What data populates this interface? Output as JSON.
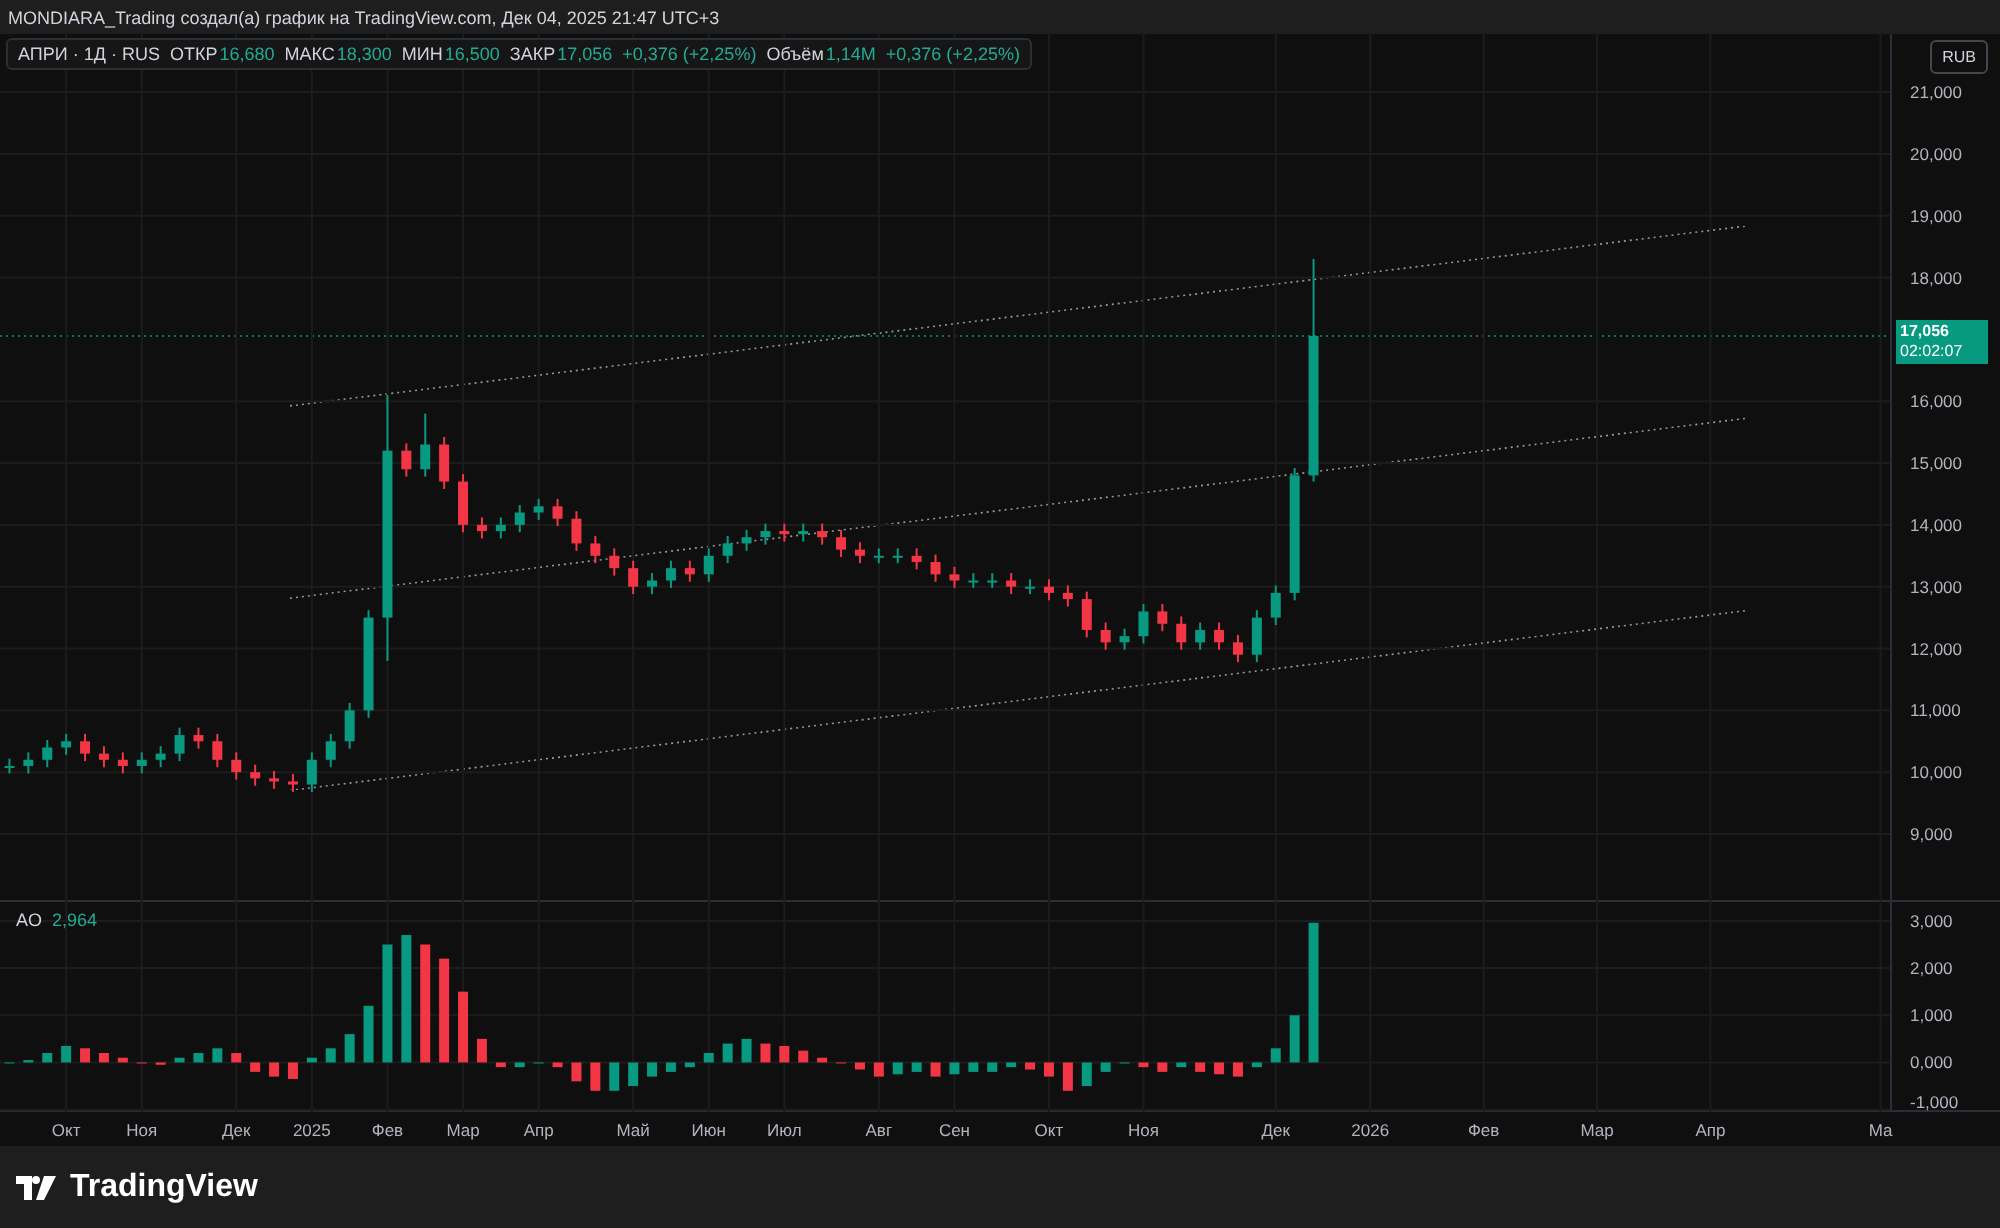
{
  "header": {
    "text": "MONDIARA_Trading создал(а) график на TradingView.com, Дек 04, 2025 21:47 UTC+3"
  },
  "legend": {
    "symbol": "АПРИ · 1Д · RUS",
    "fields": [
      {
        "label": "ОТКР",
        "value": "16,680"
      },
      {
        "label": "МАКС",
        "value": "18,300"
      },
      {
        "label": "МИН",
        "value": "16,500"
      },
      {
        "label": "ЗАКР",
        "value": "17,056"
      }
    ],
    "change": "+0,376 (+2,25%)",
    "volume": {
      "label": "Объём",
      "value": "1,14M",
      "change": "+0,376 (+2,25%)"
    }
  },
  "price_axis": {
    "currency_button": "RUB",
    "last_price": "17,056",
    "countdown": "02:02:07"
  },
  "main_chart": {
    "chart_data": {
      "type": "candlestick",
      "grid": true,
      "ylim": [
        7.9,
        21.94
      ],
      "categories": [
        null,
        null,
        null,
        null,
        null,
        null,
        null,
        null,
        null,
        null,
        null,
        null,
        null,
        null,
        null,
        null,
        null,
        null,
        null,
        null,
        null,
        null,
        null,
        null,
        null,
        null,
        null,
        null,
        null,
        null,
        null,
        null,
        null,
        null,
        null,
        null,
        null,
        null,
        null,
        null,
        null,
        null,
        null,
        null,
        null,
        null,
        null,
        null,
        null,
        null,
        null,
        null,
        null,
        null,
        null,
        null,
        null,
        null,
        null,
        null,
        null,
        null,
        null,
        null,
        null,
        null,
        null,
        null,
        null,
        null,
        null,
        null,
        null,
        null,
        null,
        null,
        null,
        null,
        null,
        null,
        null,
        null,
        null,
        null,
        null,
        null,
        null,
        null,
        null,
        null,
        null,
        null,
        null,
        null,
        null,
        null,
        null,
        null,
        null,
        null
      ],
      "ohlc": [
        [
          10.1,
          10.22,
          9.98,
          10.1
        ],
        [
          10.1,
          10.32,
          9.98,
          10.2
        ],
        [
          10.2,
          10.52,
          10.08,
          10.4
        ],
        [
          10.4,
          10.62,
          10.28,
          10.5
        ],
        [
          10.5,
          10.62,
          10.18,
          10.3
        ],
        [
          10.3,
          10.42,
          10.08,
          10.2
        ],
        [
          10.2,
          10.32,
          9.98,
          10.1
        ],
        [
          10.1,
          10.32,
          9.98,
          10.2
        ],
        [
          10.2,
          10.42,
          10.08,
          10.3
        ],
        [
          10.3,
          10.72,
          10.18,
          10.6
        ],
        [
          10.6,
          10.72,
          10.38,
          10.5
        ],
        [
          10.5,
          10.62,
          10.08,
          10.2
        ],
        [
          10.2,
          10.32,
          9.88,
          10.0
        ],
        [
          10.0,
          10.12,
          9.78,
          9.9
        ],
        [
          9.9,
          10.02,
          9.73,
          9.85
        ],
        [
          9.85,
          9.97,
          9.68,
          9.8
        ],
        [
          9.8,
          10.32,
          9.68,
          10.2
        ],
        [
          10.2,
          10.62,
          10.08,
          10.5
        ],
        [
          10.5,
          11.12,
          10.38,
          11.0
        ],
        [
          11.0,
          12.62,
          10.88,
          12.5
        ],
        [
          12.5,
          16.1,
          11.8,
          15.2
        ],
        [
          15.2,
          15.32,
          14.78,
          14.9
        ],
        [
          14.9,
          15.8,
          14.78,
          15.3
        ],
        [
          15.3,
          15.42,
          14.58,
          14.7
        ],
        [
          14.7,
          14.82,
          13.88,
          14.0
        ],
        [
          14.0,
          14.12,
          13.78,
          13.9
        ],
        [
          13.9,
          14.12,
          13.78,
          14.0
        ],
        [
          14.0,
          14.32,
          13.88,
          14.2
        ],
        [
          14.2,
          14.42,
          14.08,
          14.3
        ],
        [
          14.3,
          14.42,
          13.98,
          14.1
        ],
        [
          14.1,
          14.22,
          13.58,
          13.7
        ],
        [
          13.7,
          13.82,
          13.38,
          13.5
        ],
        [
          13.5,
          13.62,
          13.18,
          13.3
        ],
        [
          13.3,
          13.42,
          12.88,
          13.0
        ],
        [
          13.0,
          13.22,
          12.88,
          13.1
        ],
        [
          13.1,
          13.42,
          12.98,
          13.3
        ],
        [
          13.3,
          13.42,
          13.08,
          13.2
        ],
        [
          13.2,
          13.62,
          13.08,
          13.5
        ],
        [
          13.5,
          13.82,
          13.38,
          13.7
        ],
        [
          13.7,
          13.92,
          13.58,
          13.8
        ],
        [
          13.8,
          14.02,
          13.68,
          13.9
        ],
        [
          13.9,
          14.02,
          13.73,
          13.85
        ],
        [
          13.85,
          14.02,
          13.73,
          13.9
        ],
        [
          13.9,
          14.02,
          13.68,
          13.8
        ],
        [
          13.8,
          13.92,
          13.48,
          13.6
        ],
        [
          13.6,
          13.72,
          13.38,
          13.5
        ],
        [
          13.5,
          13.62,
          13.38,
          13.5
        ],
        [
          13.5,
          13.62,
          13.38,
          13.5
        ],
        [
          13.5,
          13.62,
          13.28,
          13.4
        ],
        [
          13.4,
          13.52,
          13.08,
          13.2
        ],
        [
          13.2,
          13.32,
          12.98,
          13.1
        ],
        [
          13.1,
          13.22,
          12.98,
          13.1
        ],
        [
          13.1,
          13.22,
          12.98,
          13.1
        ],
        [
          13.1,
          13.22,
          12.88,
          13.0
        ],
        [
          13.0,
          13.12,
          12.88,
          13.0
        ],
        [
          13.0,
          13.12,
          12.78,
          12.9
        ],
        [
          12.9,
          13.02,
          12.68,
          12.8
        ],
        [
          12.8,
          12.92,
          12.18,
          12.3
        ],
        [
          12.3,
          12.42,
          11.98,
          12.1
        ],
        [
          12.1,
          12.32,
          11.98,
          12.2
        ],
        [
          12.2,
          12.72,
          12.08,
          12.6
        ],
        [
          12.6,
          12.72,
          12.28,
          12.4
        ],
        [
          12.4,
          12.52,
          11.98,
          12.1
        ],
        [
          12.1,
          12.42,
          11.98,
          12.3
        ],
        [
          12.3,
          12.42,
          11.98,
          12.1
        ],
        [
          12.1,
          12.22,
          11.78,
          11.9
        ],
        [
          11.9,
          12.62,
          11.78,
          12.5
        ],
        [
          12.5,
          13.02,
          12.38,
          12.9
        ],
        [
          12.9,
          14.92,
          12.78,
          14.8
        ],
        [
          14.8,
          18.3,
          14.7,
          17.056
        ],
        null,
        null,
        null,
        null,
        null,
        null,
        null,
        null,
        null,
        null,
        null,
        null,
        null,
        null,
        null,
        null,
        null,
        null,
        null,
        null,
        null,
        null,
        null,
        null,
        null,
        null,
        null,
        null,
        null,
        null
      ],
      "yticks": [
        {
          "value": 21,
          "label": "21,000"
        },
        {
          "value": 20,
          "label": "20,000"
        },
        {
          "value": 19,
          "label": "19,000"
        },
        {
          "value": 18,
          "label": "18,000"
        },
        {
          "value": 16,
          "label": "16,000"
        },
        {
          "value": 15,
          "label": "15,000"
        },
        {
          "value": 14,
          "label": "14,000"
        },
        {
          "value": 13,
          "label": "13,000"
        },
        {
          "value": 12,
          "label": "12,000"
        },
        {
          "value": 11,
          "label": "11,000"
        },
        {
          "value": 10,
          "label": "10,000"
        },
        {
          "value": 9,
          "label": "9,000"
        }
      ]
    }
  },
  "indicator": {
    "name": "AO",
    "value": "2,964",
    "chart_data": {
      "type": "bar",
      "grid": true,
      "ylim": [
        -1.05,
        3.4
      ],
      "categories": [
        null,
        null,
        null,
        "Окт",
        null,
        null,
        null,
        "Ноя",
        null,
        null,
        null,
        null,
        "Дек",
        null,
        null,
        null,
        "2025",
        null,
        null,
        null,
        "Фев",
        null,
        null,
        null,
        "Мар",
        null,
        null,
        null,
        "Апр",
        null,
        null,
        null,
        null,
        "Май",
        null,
        null,
        null,
        "Июн",
        null,
        null,
        null,
        "Июл",
        null,
        null,
        null,
        null,
        "Авг",
        null,
        null,
        null,
        "Сен",
        null,
        null,
        null,
        null,
        "Окт",
        null,
        null,
        null,
        null,
        "Ноя",
        null,
        null,
        null,
        null,
        null,
        null,
        "Дек",
        null,
        null,
        null,
        null,
        "2026",
        null,
        null,
        null,
        null,
        null,
        "Фев",
        null,
        null,
        null,
        null,
        null,
        "Мар",
        null,
        null,
        null,
        null,
        null,
        "Апр",
        null,
        null,
        null,
        null,
        null,
        null,
        null,
        null,
        "Ма"
      ],
      "series": [
        {
          "color": "#089981",
          "values": [
            0,
            0.05,
            0.2,
            0.35,
            null,
            null,
            null,
            null,
            null,
            0.1,
            0.2,
            0.3,
            null,
            null,
            null,
            null,
            0.1,
            0.3,
            0.6,
            1.2,
            2.5,
            2.7,
            null,
            null,
            null,
            null,
            null,
            -0.1,
            0.0,
            null,
            null,
            null,
            -0.6,
            -0.5,
            -0.3,
            -0.2,
            -0.1,
            0.2,
            0.4,
            0.5,
            null,
            null,
            null,
            null,
            null,
            null,
            null,
            -0.25,
            -0.2,
            null,
            -0.25,
            -0.2,
            -0.2,
            -0.1,
            null,
            null,
            null,
            -0.5,
            -0.2,
            0.0,
            null,
            null,
            -0.1,
            null,
            null,
            null,
            -0.1,
            0.3,
            1.0,
            2.96,
            null,
            null,
            null,
            null,
            null,
            null,
            null,
            null,
            null,
            null,
            null,
            null,
            null,
            null,
            null,
            null,
            null,
            null,
            null,
            null,
            null,
            null,
            null,
            null,
            null,
            null,
            null,
            null,
            null,
            null
          ]
        },
        {
          "color": "#f23645",
          "values": [
            null,
            null,
            null,
            null,
            0.3,
            0.2,
            0.1,
            0.0,
            -0.05,
            null,
            null,
            null,
            0.2,
            -0.2,
            -0.3,
            -0.35,
            null,
            null,
            null,
            null,
            null,
            null,
            2.5,
            2.2,
            1.5,
            0.5,
            -0.1,
            null,
            null,
            -0.1,
            -0.4,
            -0.6,
            null,
            null,
            null,
            null,
            null,
            null,
            null,
            null,
            0.4,
            0.35,
            0.25,
            0.1,
            0.0,
            -0.15,
            -0.3,
            null,
            null,
            -0.3,
            null,
            null,
            null,
            null,
            -0.15,
            -0.3,
            -0.6,
            null,
            null,
            null,
            -0.1,
            -0.2,
            null,
            -0.2,
            -0.25,
            -0.3,
            null,
            null,
            null,
            null,
            null,
            null,
            null,
            null,
            null,
            null,
            null,
            null,
            null,
            null,
            null,
            null,
            null,
            null,
            null,
            null,
            null,
            null,
            null,
            null,
            null,
            null,
            null,
            null,
            null,
            null,
            null,
            null,
            null,
            null
          ]
        }
      ],
      "yticks": [
        {
          "value": 3,
          "label": "3,000"
        },
        {
          "value": 2,
          "label": "2,000"
        },
        {
          "value": 1,
          "label": "1,000"
        },
        {
          "value": 0,
          "label": "0,000"
        },
        {
          "value": -1,
          "label": "-1,000"
        }
      ]
    }
  },
  "footer": {
    "logo_text": "TradingView"
  }
}
